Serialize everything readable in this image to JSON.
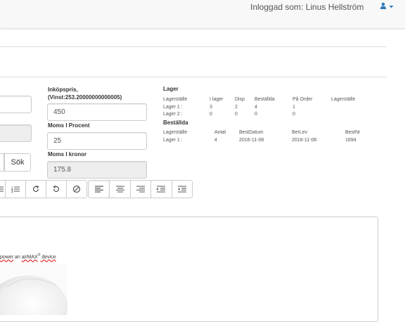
{
  "header": {
    "user_text": "Inloggad som: Linus Hellström"
  },
  "search": {
    "button_label": "Sök"
  },
  "price": {
    "inkop_label_line1": "Inköpspris,",
    "inkop_label_line2": "(Vinst:253.20000000000005)",
    "inkop_value": "450",
    "moms_procent_label": "Moms I Procent",
    "moms_procent_value": "25",
    "moms_kronor_label": "Moms I kronor",
    "moms_kronor_value": "175.8"
  },
  "lager": {
    "title": "Lager",
    "headers": [
      "Lagerställe",
      "I lager",
      "Disp",
      "Beställda",
      "På Order",
      "Lagerställe"
    ],
    "rows": [
      [
        "Lager 1 :",
        "3",
        "2",
        "4",
        "1"
      ],
      [
        "Lager 2 :",
        "0",
        "0",
        "0",
        "0"
      ]
    ]
  },
  "bestallda": {
    "title": "Beställda",
    "headers": [
      "Lagerställe",
      "Antal",
      "BestDatum",
      "BerLev",
      "BestNr"
    ],
    "rows": [
      [
        "Lager 1 :",
        "4",
        "2016-11-08",
        "2016-11-08",
        "1694"
      ]
    ]
  },
  "editor": {
    "text_before": "power",
    "text_mid": " an ",
    "text_brand": "airMAX",
    "text_reg": "®",
    "text_after": " device",
    "toolbar_icons": [
      "list-icon",
      "numbered-list-icon",
      "redo-icon",
      "undo-icon",
      "clear-format-icon",
      "align-left-icon",
      "align-center-icon",
      "align-right-icon",
      "indent-icon",
      "outdent-icon"
    ]
  }
}
